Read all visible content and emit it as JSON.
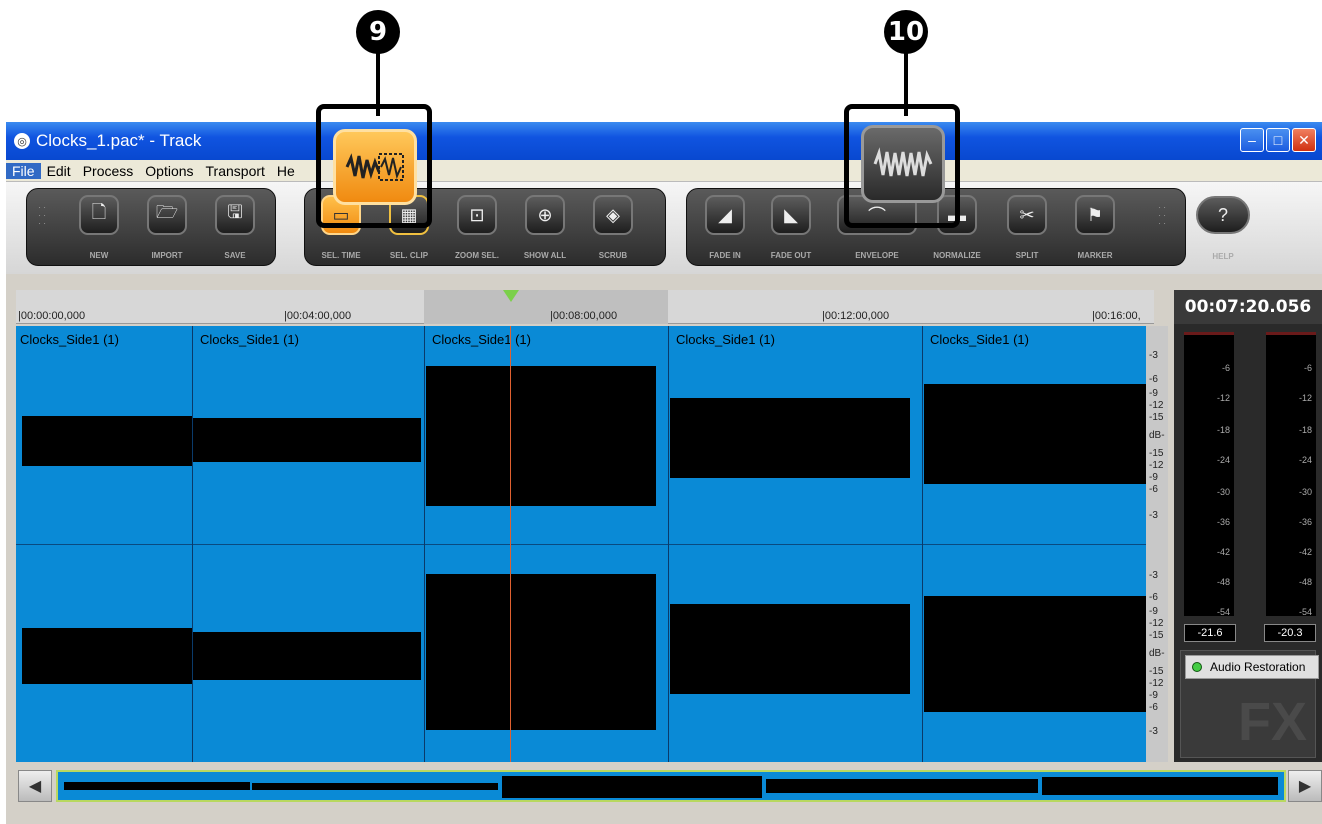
{
  "callouts": {
    "c9": "9",
    "c10": "10"
  },
  "window": {
    "title": "Clocks_1.pac* - Track",
    "btn_min": "–",
    "btn_max": "□",
    "btn_close": "✕"
  },
  "menu": [
    {
      "label": "File",
      "active": true
    },
    {
      "label": "Edit"
    },
    {
      "label": "Process"
    },
    {
      "label": "Options"
    },
    {
      "label": "Transport"
    },
    {
      "label": "He"
    }
  ],
  "toolbar": {
    "new": "NEW",
    "import": "IMPORT",
    "save": "SAVE",
    "sel_time": "SEL. TIME",
    "sel_clip": "SEL. CLIP",
    "zoom_sel": "ZOOM SEL.",
    "show_all": "SHOW ALL",
    "scrub": "SCRUB",
    "fade_in": "FADE IN",
    "fade_out": "FADE OUT",
    "envelope": "ENVELOPE",
    "normalize": "NORMALIZE",
    "split": "SPLIT",
    "marker": "MARKER",
    "help": "HELP"
  },
  "ruler": {
    "t0": "|00:00:00,000",
    "t4": "|00:04:00,000",
    "t8": "|00:08:00,000",
    "t12": "|00:12:00,000",
    "t16": "|00:16:00,"
  },
  "clips": [
    "Clocks_Side1 (1)",
    "Clocks_Side1 (1)",
    "Clocks_Side1 (1)",
    "Clocks_Side1 (1)",
    "Clocks_Side1 (1)"
  ],
  "db_scale_top": [
    "-3",
    "-6",
    "-9",
    "-12",
    "-15",
    "dB-",
    "-15",
    "-12",
    "-9",
    "-6",
    "-3"
  ],
  "meters": {
    "time": "00:07:20.056",
    "scale": [
      "-6",
      "-12",
      "-18",
      "-24",
      "-30",
      "-36",
      "-42",
      "-48",
      "-54"
    ],
    "left_readout": "-21.6",
    "right_readout": "-20.3"
  },
  "fx": {
    "plugin": "Audio Restoration",
    "watermark": "FX"
  },
  "colors": {
    "track_bg": "#0a8ad6",
    "accent_orange": "#f0a020",
    "titlebar": "#0848d0"
  }
}
